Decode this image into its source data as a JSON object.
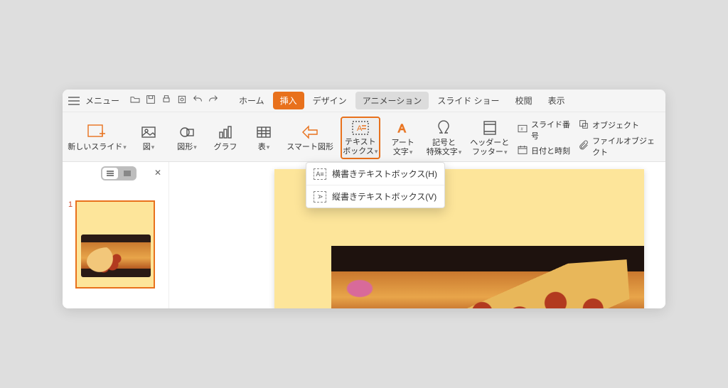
{
  "menu": {
    "label": "メニュー"
  },
  "tabs": {
    "home": "ホーム",
    "insert": "挿入",
    "design": "デザイン",
    "animation": "アニメーション",
    "slideshow": "スライド ショー",
    "review": "校閲",
    "view": "表示"
  },
  "ribbon": {
    "new_slide": "新しいスライド",
    "picture": "図",
    "shapes": "図形",
    "chart": "グラフ",
    "table": "表",
    "smart_shape": "スマート図形",
    "text_box_l1": "テキスト",
    "text_box_l2": "ボックス",
    "wordart_l1": "アート",
    "wordart_l2": "文字",
    "symbol_l1": "記号と",
    "symbol_l2": "特殊文字",
    "header_l1": "ヘッダーと",
    "header_l2": "フッター",
    "slide_number": "スライド番号",
    "date_time": "日付と時刻",
    "object": "オブジェクト",
    "file_object": "ファイルオブジェクト"
  },
  "dropdown": {
    "horizontal": "横書きテキストボックス(H)",
    "vertical": "縦書きテキストボックス(V)"
  },
  "panel": {
    "slide_number": "1"
  }
}
